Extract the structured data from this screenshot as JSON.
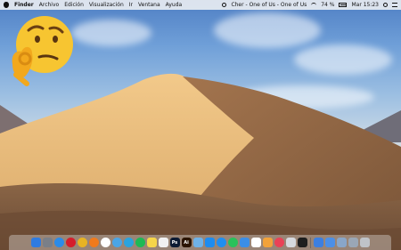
{
  "menubar": {
    "app_name": "Finder",
    "menus": [
      "Archivo",
      "Edición",
      "Visualización",
      "Ir",
      "Ventana",
      "Ayuda"
    ],
    "now_playing": "Cher - One of Us - One of Us",
    "battery": "74 %",
    "datetime": "Mar 15:23"
  },
  "desktop": {
    "wallpaper": "macOS Mojave day",
    "emoji": "thinking-face-ok-hand"
  },
  "dock": {
    "apps": [
      {
        "name": "finder-icon",
        "color": "#2f7be0",
        "glyph": ""
      },
      {
        "name": "launchpad-icon",
        "color": "#7a7f88",
        "glyph": ""
      },
      {
        "name": "safari-icon",
        "color": "#2b8be8",
        "glyph": ""
      },
      {
        "name": "opera-icon",
        "color": "#d51d2c",
        "glyph": ""
      },
      {
        "name": "chrome-icon",
        "color": "#e7b324",
        "glyph": ""
      },
      {
        "name": "firefox-icon",
        "color": "#f07a1c",
        "glyph": ""
      },
      {
        "name": "clock-icon",
        "color": "#ffffff",
        "glyph": ""
      },
      {
        "name": "tweetbot-icon",
        "color": "#4aa5e6",
        "glyph": ""
      },
      {
        "name": "telegram-icon",
        "color": "#2aa3de",
        "glyph": ""
      },
      {
        "name": "spotify-icon",
        "color": "#1db954",
        "glyph": ""
      },
      {
        "name": "notes-icon",
        "color": "#f5d54a",
        "glyph": ""
      },
      {
        "name": "textedit-icon",
        "color": "#f1f1f1",
        "glyph": ""
      },
      {
        "name": "photoshop-icon",
        "color": "#0d1b33",
        "glyph": "Ps"
      },
      {
        "name": "illustrator-icon",
        "color": "#2a1400",
        "glyph": "Ai"
      },
      {
        "name": "preview-icon",
        "color": "#6fb2e8",
        "glyph": ""
      },
      {
        "name": "appstore-icon",
        "color": "#1d8cf0",
        "glyph": ""
      },
      {
        "name": "messenger-icon",
        "color": "#1f8ef1",
        "glyph": ""
      },
      {
        "name": "whatsapp-icon",
        "color": "#29c15b",
        "glyph": ""
      },
      {
        "name": "mail-icon",
        "color": "#3b8ee6",
        "glyph": ""
      },
      {
        "name": "calendar-icon",
        "color": "#ffffff",
        "glyph": ""
      },
      {
        "name": "photos-icon",
        "color": "#f2a23a",
        "glyph": ""
      },
      {
        "name": "music-icon",
        "color": "#e94257",
        "glyph": ""
      },
      {
        "name": "appfolder-icon",
        "color": "#d6d9de",
        "glyph": ""
      },
      {
        "name": "terminal-icon",
        "color": "#1e1e1e",
        "glyph": ""
      }
    ],
    "right_items": [
      {
        "name": "system-prefs-icon",
        "color": "#3c7fe0",
        "glyph": ""
      },
      {
        "name": "downloads-icon",
        "color": "#4c8fe6",
        "glyph": ""
      },
      {
        "name": "stack-folder-icon",
        "color": "#89a6c8",
        "glyph": ""
      },
      {
        "name": "screenshot-stack-icon",
        "color": "#9aa7b6",
        "glyph": ""
      },
      {
        "name": "trash-icon",
        "color": "#bfc3c8",
        "glyph": ""
      }
    ]
  }
}
